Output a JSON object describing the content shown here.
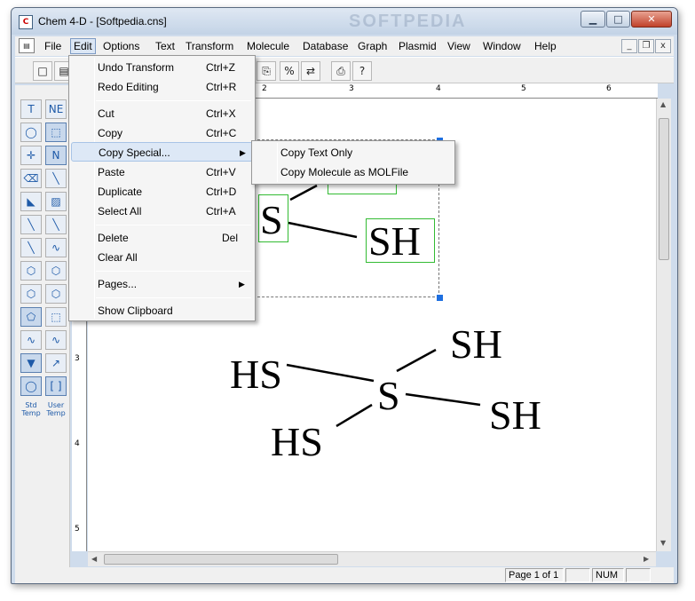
{
  "window": {
    "title": "Chem 4-D - [Softpedia.cns]",
    "watermark": "SOFTPEDIA",
    "minimize": "▁",
    "maximize": "□",
    "close": "✕"
  },
  "menubar": {
    "doc_icon": "doc-icon",
    "items": [
      "File",
      "Edit",
      "Options",
      "Text",
      "Transform",
      "Molecule",
      "Database",
      "Graph",
      "Plasmid",
      "View",
      "Window",
      "Help"
    ],
    "active": "Edit",
    "mdi_min": "_",
    "mdi_restore": "❐",
    "mdi_close": "x"
  },
  "toolbar": {
    "buttons": [
      "new-icon",
      "open-icon",
      "copy-icon",
      "percent-icon",
      "move-icon",
      "print-icon",
      "help-icon"
    ],
    "glyphs": [
      "□",
      "▤",
      "⎘",
      "%",
      "⇄",
      "⎙",
      "?"
    ]
  },
  "palette": {
    "tools": [
      "T",
      "NE",
      "◯",
      "⬚",
      "✛",
      "N",
      "⌫",
      "╲",
      "◣",
      "▨",
      "╲",
      "╲",
      "╲",
      "∿",
      "⬡",
      "⬡",
      "⬡",
      "⬡",
      "⬠",
      "⬚",
      "∿",
      "∿",
      "▼",
      "↗",
      "◯",
      "[ ]"
    ],
    "std_label": "Std Temp",
    "user_label": "User Temp"
  },
  "ruler": {
    "h_ticks": [
      "2",
      "3",
      "4",
      "5",
      "6"
    ],
    "v_ticks": [
      "3",
      "4",
      "5"
    ]
  },
  "edit_menu": {
    "items": [
      {
        "label": "Undo Transform",
        "shortcut": "Ctrl+Z"
      },
      {
        "label": "Redo Editing",
        "shortcut": "Ctrl+R"
      },
      {
        "label": "Cut",
        "shortcut": "Ctrl+X"
      },
      {
        "label": "Copy",
        "shortcut": "Ctrl+C"
      },
      {
        "label": "Copy Special...",
        "shortcut": ""
      },
      {
        "label": "Paste",
        "shortcut": "Ctrl+V"
      },
      {
        "label": "Duplicate",
        "shortcut": "Ctrl+D"
      },
      {
        "label": "Select All",
        "shortcut": "Ctrl+A"
      },
      {
        "label": "Delete",
        "shortcut": "Del"
      },
      {
        "label": "Clear All",
        "shortcut": ""
      },
      {
        "label": "Pages...",
        "shortcut": ""
      },
      {
        "label": "Show Clipboard",
        "shortcut": ""
      }
    ],
    "highlighted": "Copy Special..."
  },
  "copy_special_submenu": {
    "items": [
      "Copy Text Only",
      "Copy Molecule as MOLFile"
    ]
  },
  "canvas": {
    "selected_molecule": {
      "atoms": [
        "S",
        "SH"
      ]
    },
    "molecule": {
      "center": "S",
      "substituents": [
        "HS",
        "SH",
        "SH",
        "HS"
      ]
    }
  },
  "statusbar": {
    "page": "Page 1 of 1",
    "num": "NUM"
  }
}
